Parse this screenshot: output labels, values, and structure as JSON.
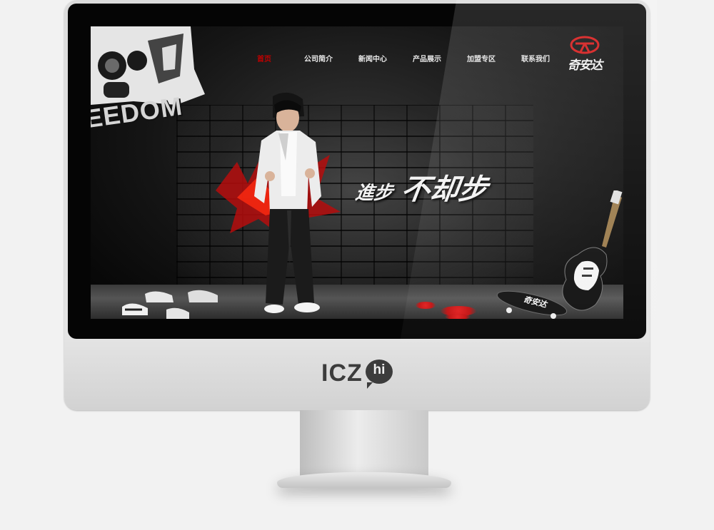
{
  "nav": {
    "items": [
      {
        "label": "首页",
        "active": true
      },
      {
        "label": "公司简介",
        "active": false
      },
      {
        "label": "新闻中心",
        "active": false
      },
      {
        "label": "产品展示",
        "active": false
      },
      {
        "label": "加盟专区",
        "active": false
      },
      {
        "label": "联系我们",
        "active": false
      }
    ]
  },
  "brand": {
    "name": "奇安达"
  },
  "graffiti": {
    "text": "EEDOM"
  },
  "hero": {
    "slogan_left": "進步",
    "slogan_right": "不却步"
  },
  "skateboard": {
    "text": "奇安达"
  },
  "monitor": {
    "chin_letters": "ICZ",
    "chin_bubble": "hi"
  },
  "colors": {
    "nav_active_text": "#c00000",
    "nav_active_splash": "#f4e600",
    "brand_red": "#d41414",
    "background": "#050505"
  }
}
